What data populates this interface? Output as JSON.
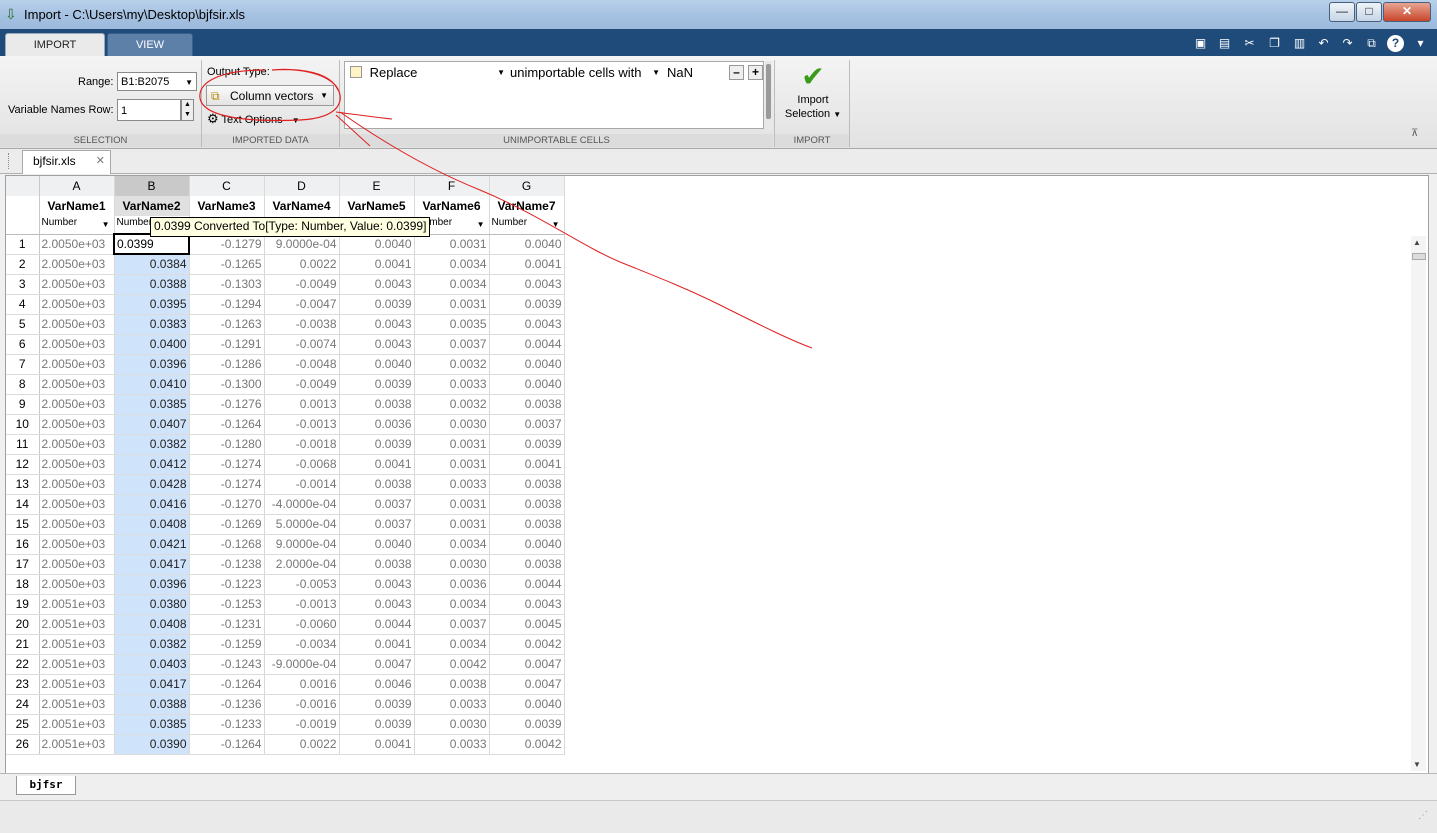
{
  "window": {
    "title": "Import - C:\\Users\\my\\Desktop\\bjfsir.xls",
    "minimize": "—",
    "maximize": "□",
    "close": "✕"
  },
  "tabs": {
    "import": "IMPORT",
    "view": "VIEW"
  },
  "selection": {
    "range_label": "Range:",
    "range_value": "B1:B2075",
    "var_names_row_label": "Variable Names Row:",
    "var_names_row_value": "1",
    "group_label": "SELECTION"
  },
  "imported_data": {
    "output_type_label": "Output Type:",
    "output_type_value": "Column vectors",
    "text_options": "Text Options",
    "group_label": "IMPORTED DATA"
  },
  "unimportable": {
    "rule_action": "Replace",
    "rule_target": "unimportable cells with",
    "rule_value": "NaN",
    "remove": "–",
    "add": "+",
    "group_label": "UNIMPORTABLE CELLS"
  },
  "import_group": {
    "button_line1": "Import",
    "button_line2": "Selection",
    "group_label": "IMPORT"
  },
  "document_tab": {
    "label": "bjfsir.xls"
  },
  "tooltip": "0.0399 Converted To[Type: Number, Value: 0.0399]",
  "grid": {
    "columns": [
      {
        "letter": "A",
        "name": "VarName1",
        "type": "Number"
      },
      {
        "letter": "B",
        "name": "VarName2",
        "type": "Number"
      },
      {
        "letter": "C",
        "name": "VarName3",
        "type": "Number"
      },
      {
        "letter": "D",
        "name": "VarName4",
        "type": "Number"
      },
      {
        "letter": "E",
        "name": "VarName5",
        "type": "Number"
      },
      {
        "letter": "F",
        "name": "VarName6",
        "type": "Number"
      },
      {
        "letter": "G",
        "name": "VarName7",
        "type": "Number"
      }
    ],
    "rows": [
      [
        "1",
        "2.0050e+03",
        "0.0399",
        "-0.1279",
        "9.0000e-04",
        "0.0040",
        "0.0031",
        "0.0040"
      ],
      [
        "2",
        "2.0050e+03",
        "0.0384",
        "-0.1265",
        "0.0022",
        "0.0041",
        "0.0034",
        "0.0041"
      ],
      [
        "3",
        "2.0050e+03",
        "0.0388",
        "-0.1303",
        "-0.0049",
        "0.0043",
        "0.0034",
        "0.0043"
      ],
      [
        "4",
        "2.0050e+03",
        "0.0395",
        "-0.1294",
        "-0.0047",
        "0.0039",
        "0.0031",
        "0.0039"
      ],
      [
        "5",
        "2.0050e+03",
        "0.0383",
        "-0.1263",
        "-0.0038",
        "0.0043",
        "0.0035",
        "0.0043"
      ],
      [
        "6",
        "2.0050e+03",
        "0.0400",
        "-0.1291",
        "-0.0074",
        "0.0043",
        "0.0037",
        "0.0044"
      ],
      [
        "7",
        "2.0050e+03",
        "0.0396",
        "-0.1286",
        "-0.0048",
        "0.0040",
        "0.0032",
        "0.0040"
      ],
      [
        "8",
        "2.0050e+03",
        "0.0410",
        "-0.1300",
        "-0.0049",
        "0.0039",
        "0.0033",
        "0.0040"
      ],
      [
        "9",
        "2.0050e+03",
        "0.0385",
        "-0.1276",
        "0.0013",
        "0.0038",
        "0.0032",
        "0.0038"
      ],
      [
        "10",
        "2.0050e+03",
        "0.0407",
        "-0.1264",
        "-0.0013",
        "0.0036",
        "0.0030",
        "0.0037"
      ],
      [
        "11",
        "2.0050e+03",
        "0.0382",
        "-0.1280",
        "-0.0018",
        "0.0039",
        "0.0031",
        "0.0039"
      ],
      [
        "12",
        "2.0050e+03",
        "0.0412",
        "-0.1274",
        "-0.0068",
        "0.0041",
        "0.0031",
        "0.0041"
      ],
      [
        "13",
        "2.0050e+03",
        "0.0428",
        "-0.1274",
        "-0.0014",
        "0.0038",
        "0.0033",
        "0.0038"
      ],
      [
        "14",
        "2.0050e+03",
        "0.0416",
        "-0.1270",
        "-4.0000e-04",
        "0.0037",
        "0.0031",
        "0.0038"
      ],
      [
        "15",
        "2.0050e+03",
        "0.0408",
        "-0.1269",
        "5.0000e-04",
        "0.0037",
        "0.0031",
        "0.0038"
      ],
      [
        "16",
        "2.0050e+03",
        "0.0421",
        "-0.1268",
        "9.0000e-04",
        "0.0040",
        "0.0034",
        "0.0040"
      ],
      [
        "17",
        "2.0050e+03",
        "0.0417",
        "-0.1238",
        "2.0000e-04",
        "0.0038",
        "0.0030",
        "0.0038"
      ],
      [
        "18",
        "2.0050e+03",
        "0.0396",
        "-0.1223",
        "-0.0053",
        "0.0043",
        "0.0036",
        "0.0044"
      ],
      [
        "19",
        "2.0051e+03",
        "0.0380",
        "-0.1253",
        "-0.0013",
        "0.0043",
        "0.0034",
        "0.0043"
      ],
      [
        "20",
        "2.0051e+03",
        "0.0408",
        "-0.1231",
        "-0.0060",
        "0.0044",
        "0.0037",
        "0.0045"
      ],
      [
        "21",
        "2.0051e+03",
        "0.0382",
        "-0.1259",
        "-0.0034",
        "0.0041",
        "0.0034",
        "0.0042"
      ],
      [
        "22",
        "2.0051e+03",
        "0.0403",
        "-0.1243",
        "-9.0000e-04",
        "0.0047",
        "0.0042",
        "0.0047"
      ],
      [
        "23",
        "2.0051e+03",
        "0.0417",
        "-0.1264",
        "0.0016",
        "0.0046",
        "0.0038",
        "0.0047"
      ],
      [
        "24",
        "2.0051e+03",
        "0.0388",
        "-0.1236",
        "-0.0016",
        "0.0039",
        "0.0033",
        "0.0040"
      ],
      [
        "25",
        "2.0051e+03",
        "0.0385",
        "-0.1233",
        "-0.0019",
        "0.0039",
        "0.0030",
        "0.0039"
      ],
      [
        "26",
        "2.0051e+03",
        "0.0390",
        "-0.1264",
        "0.0022",
        "0.0041",
        "0.0033",
        "0.0042"
      ]
    ]
  },
  "sheet_tab": {
    "label": "bjfsr"
  },
  "colors": {
    "selected_column": "#cfe4fb",
    "annotation": "#e02020",
    "titlebar": "#a6c2e2",
    "tabstrip": "#1f4b7a"
  },
  "icons": [
    "import-app-icon",
    "column-vectors-icon",
    "gear-icon",
    "checkmark-icon",
    "help-icon"
  ]
}
